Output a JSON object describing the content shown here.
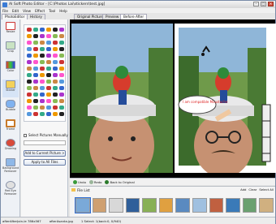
{
  "window": {
    "title": "AI Soft Photo Editor - [C:\\Photos Lai\\stickers\\test.jpg]",
    "close_glyph": "✕",
    "min_glyph": "–",
    "max_glyph": "□"
  },
  "menu": [
    "File",
    "Edit",
    "View",
    "Effect",
    "Tool",
    "Help"
  ],
  "left_tabs": [
    "PhotoEditor",
    "History"
  ],
  "view_tabs": [
    "Original Pictures",
    "Preview",
    "Before After"
  ],
  "sidebar": {
    "items": [
      "Resize",
      "Crop",
      "Color",
      "Sticker",
      "Bubble",
      "Frame",
      "Drawing",
      "Background Remover",
      "Red Eye Remover"
    ]
  },
  "panel": {
    "select_label": "Select Pictures Manually",
    "field_value": "",
    "add_button": "Add to Current Picture >",
    "apply_button": "Apply to All Files"
  },
  "speech_bubble": "I am compatible Moustache",
  "controls": {
    "undo": "Undo",
    "redo": "Redo",
    "back": "Back to Original"
  },
  "filelist": {
    "title": "File List",
    "add": "Add",
    "clear": "Clear",
    "select_all": "Select All",
    "thumb_count": 12
  },
  "status": {
    "left": "afterAfterJoin-le 786x567",
    "middle": "afterAsanta.jpg",
    "right": "1 Select: 1(back:0, 0/940)"
  },
  "colors": {
    "accent": "#2f6fd6",
    "viewer_bg": "#000000"
  }
}
